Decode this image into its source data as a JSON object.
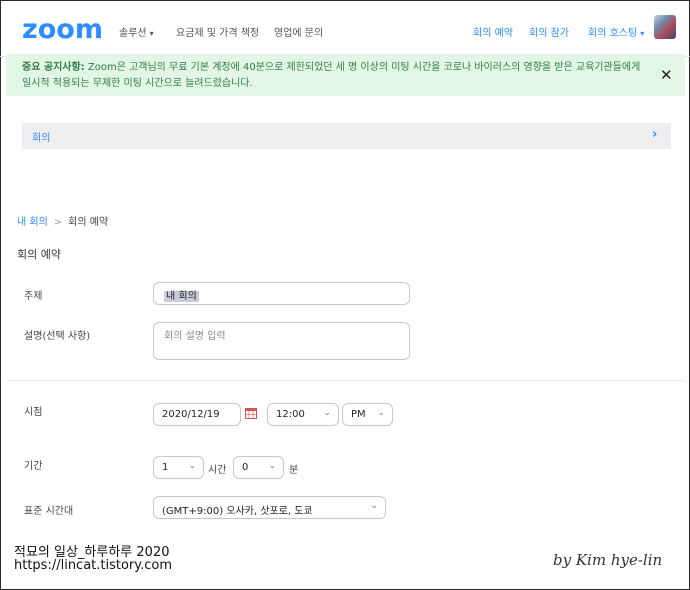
{
  "header": {
    "logo": "zoom",
    "nav_left": [
      {
        "label": "솔루션",
        "caret": "▾"
      },
      {
        "label": "요금제 및 가격 책정"
      },
      {
        "label": "영업에 문의"
      }
    ],
    "nav_right": [
      {
        "label": "회의 예약"
      },
      {
        "label": "회의 참가"
      },
      {
        "label": "회의 호스팅",
        "caret": "▾"
      }
    ]
  },
  "notice": {
    "bold": "중요 공지사항:",
    "text": " Zoom은 고객님의 무료 기본 계정에 40분으로 제한되었던 세 명 이상의 미팅 시간을 코로나 바이러스의 영향을 받은 교육기관들에게 일시적 적용되는 무제한 미팅 시간으로 늘려드렸습니다.",
    "close": "✕"
  },
  "section_bar": {
    "label": "회의",
    "chevron": "›"
  },
  "breadcrumb": {
    "link": "내 회의",
    "sep": ">",
    "current": "회의 예약"
  },
  "page_title": "회의 예약",
  "form": {
    "topic_label": "주제",
    "topic_value": "내 회의",
    "desc_label": "설명(선택 사항)",
    "desc_placeholder": "회의 설명 입력",
    "when_label": "시점",
    "date": "2020/12/19",
    "time": "12:00",
    "ampm": "PM",
    "duration_label": "기간",
    "hours": "1",
    "hours_unit": "시간",
    "minutes": "0",
    "minutes_unit": "분",
    "timezone_label": "표준 시간대",
    "timezone": "(GMT+9:00) 오사카, 삿포로, 도쿄"
  },
  "watermark": {
    "line1": "적묘의 일상_하루하루 2020",
    "line2": "https://lincat.tistory.com",
    "signature": "by Kim hye-lin"
  },
  "colors": {
    "accent": "#2d8cff",
    "notice_bg": "#e3f6e5",
    "notice_text": "#2e7d48"
  }
}
